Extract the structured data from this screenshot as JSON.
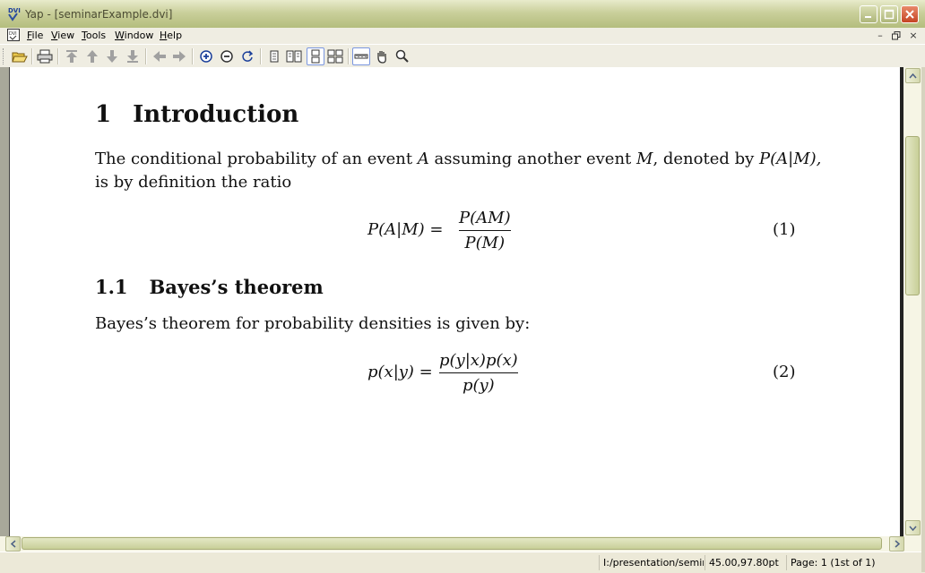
{
  "window": {
    "title": "Yap - [seminarExample.dvi]"
  },
  "menubar": {
    "items": [
      {
        "label": "File",
        "key": "F",
        "rest": "ile"
      },
      {
        "label": "View",
        "key": "V",
        "rest": "iew"
      },
      {
        "label": "Tools",
        "key": "T",
        "rest": "ools"
      },
      {
        "label": "Window",
        "key": "W",
        "rest": "indow"
      },
      {
        "label": "Help",
        "key": "H",
        "rest": "elp"
      }
    ]
  },
  "toolbar": {
    "buttons": [
      "open-icon",
      "print-icon",
      "first-page-icon",
      "previous-page-icon",
      "next-page-icon",
      "last-page-icon",
      "back-icon",
      "forward-icon",
      "zoom-in-icon",
      "zoom-out-icon",
      "refresh-icon",
      "single-page-icon",
      "double-page-icon",
      "continuous-single-icon",
      "continuous-double-icon",
      "ruler-icon",
      "hand-tool-icon",
      "magnifier-icon"
    ]
  },
  "document": {
    "section_number": "1",
    "section_title": "Introduction",
    "para1_line1": {
      "t1": "The conditional probability of an event ",
      "m1": "A",
      "t2": " assuming another event ",
      "m2": "M",
      "t3": ", denoted by ",
      "m3": "P(A|M),"
    },
    "para1_line2": "is by definition the ratio",
    "eq1": {
      "lhs": "P(A|M) =",
      "numerator": "P(AM)",
      "denominator": "P(M)",
      "number": "(1)"
    },
    "subsection_number": "1.1",
    "subsection_title": "Bayes’s theorem",
    "para2": "Bayes’s theorem for probability densities is given by:",
    "eq2": {
      "lhs": "p(x|y) =",
      "numerator": "p(y|x)p(x)",
      "denominator": "p(y)",
      "number": "(2)"
    }
  },
  "statusbar": {
    "path": "I:/presentation/seminar",
    "coords": "45.00,97.80pt",
    "page": "Page: 1 (1st of 1)"
  },
  "colors": {
    "titlebar": "#B3BC7C",
    "chrome": "#ECE9D8",
    "page": "#FFFFFF"
  }
}
